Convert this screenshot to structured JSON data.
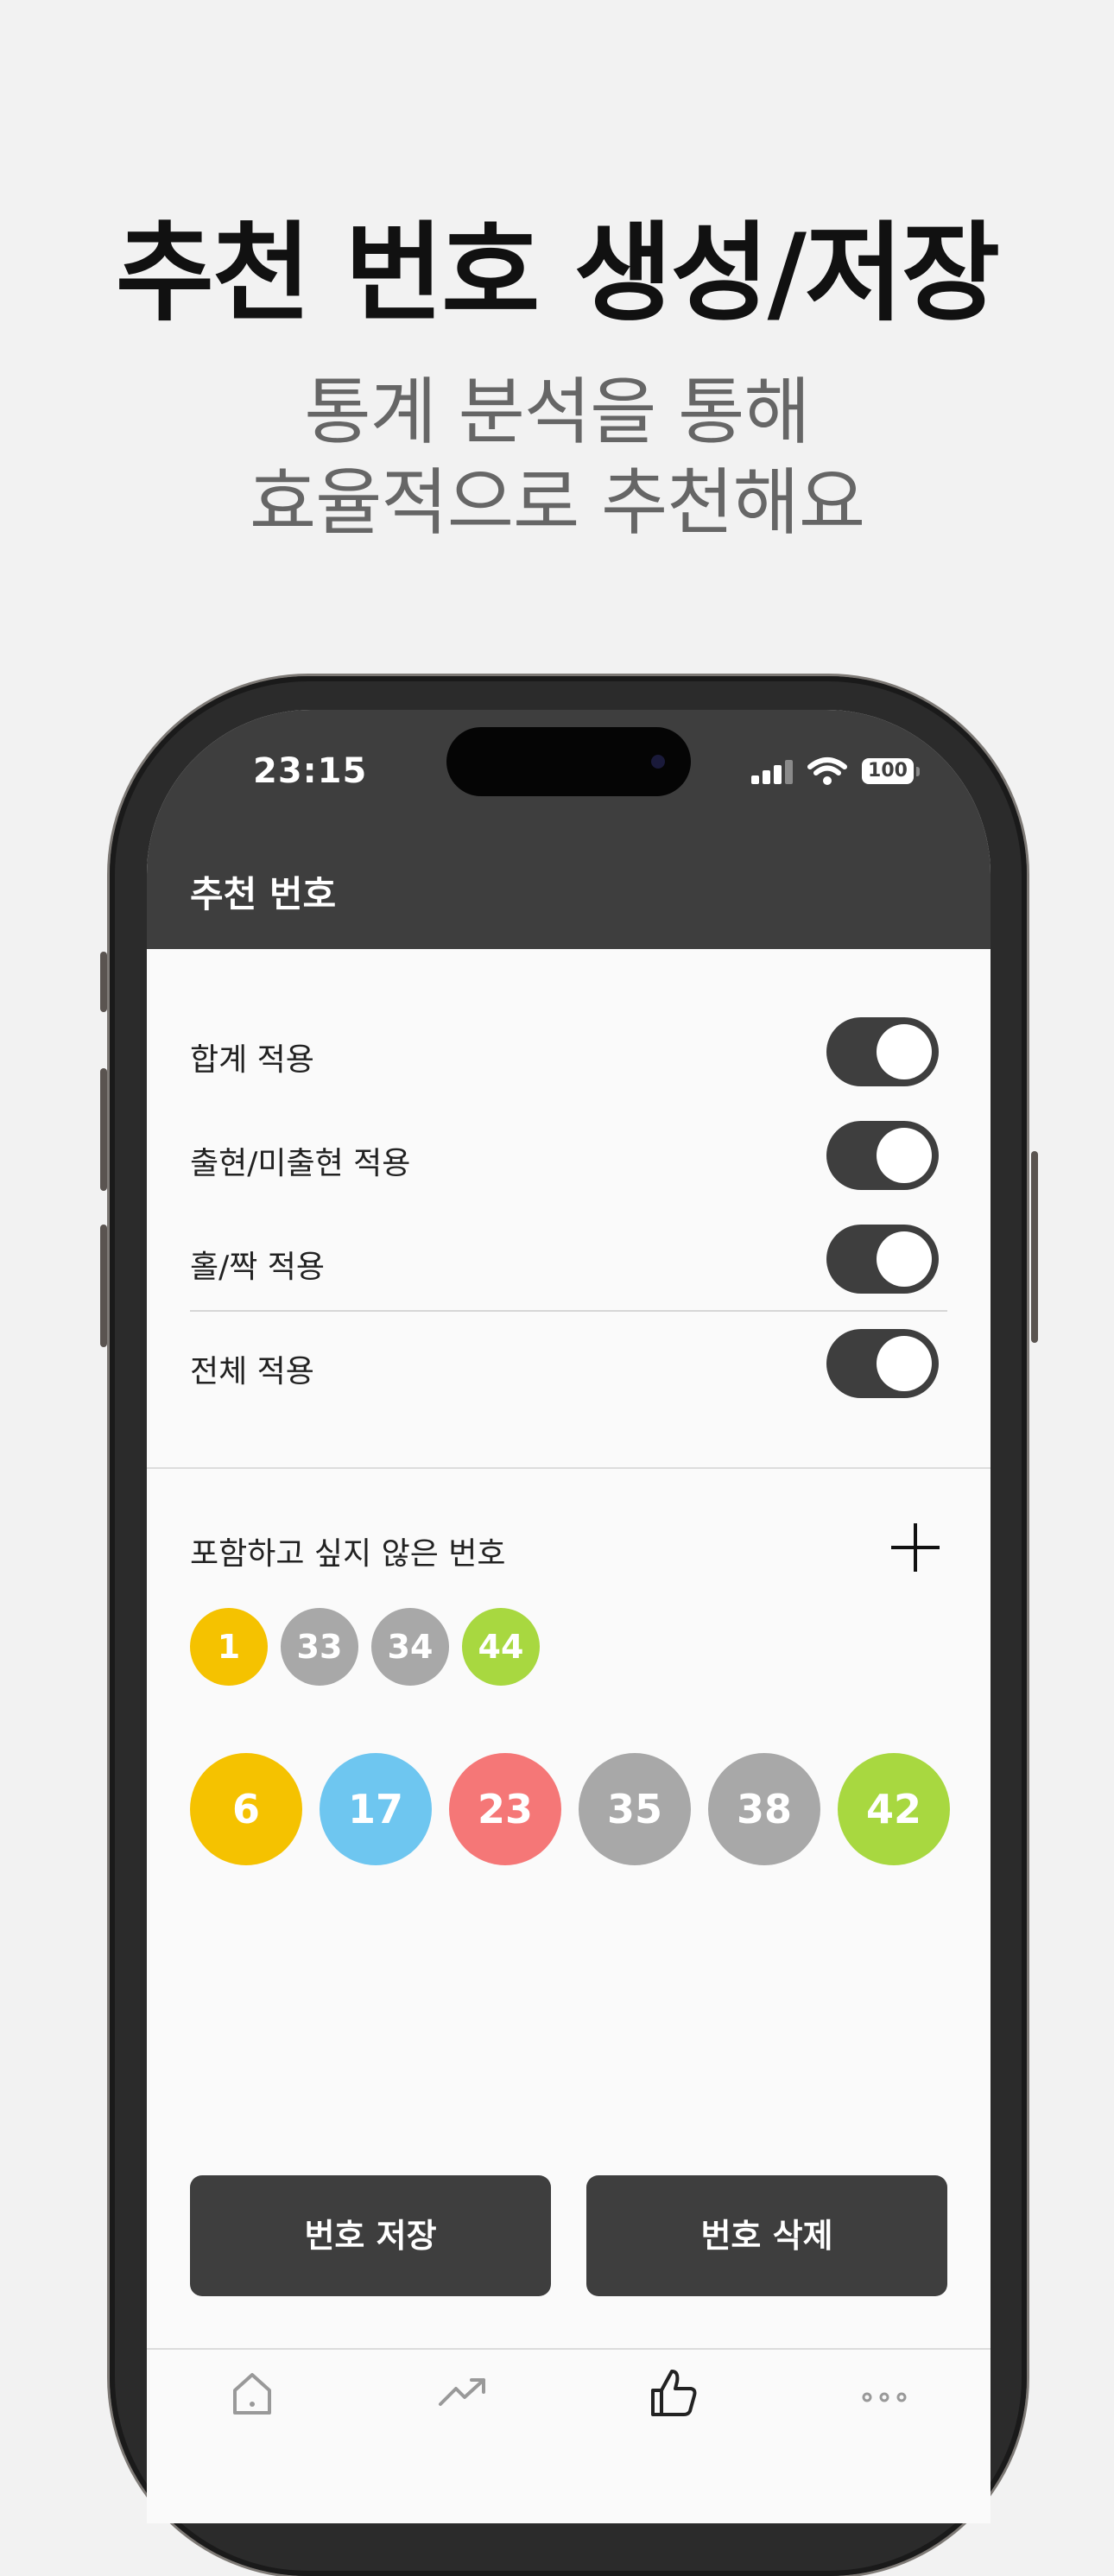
{
  "headline": "추천 번호 생성/저장",
  "subline": [
    "통계 분석을 통해",
    "효율적으로 추천해요"
  ],
  "status_bar": {
    "time": "23:15",
    "battery": "100"
  },
  "nav": {
    "title": "추천 번호"
  },
  "toggles": [
    {
      "label": "합계 적용",
      "on": true
    },
    {
      "label": "출현/미출현 적용",
      "on": true
    },
    {
      "label": "홀/짝 적용",
      "on": true
    },
    {
      "label": "전체 적용",
      "on": true
    }
  ],
  "exclude": {
    "label": "포함하고 싶지 않은 번호",
    "numbers": [
      {
        "value": "1",
        "color": "#f5c200"
      },
      {
        "value": "33",
        "color": "#a8a8a8"
      },
      {
        "value": "34",
        "color": "#a8a8a8"
      },
      {
        "value": "44",
        "color": "#a8d840"
      }
    ]
  },
  "recommended": [
    {
      "value": "6",
      "color": "#f5c200"
    },
    {
      "value": "17",
      "color": "#6ec6f0"
    },
    {
      "value": "23",
      "color": "#f57777"
    },
    {
      "value": "35",
      "color": "#a8a8a8"
    },
    {
      "value": "38",
      "color": "#a8a8a8"
    },
    {
      "value": "42",
      "color": "#a8d840"
    }
  ],
  "actions": {
    "save": "번호 저장",
    "delete": "번호 삭제"
  },
  "tabs": [
    "home-icon",
    "trend-icon",
    "thumbs-up-icon",
    "more-icon"
  ]
}
